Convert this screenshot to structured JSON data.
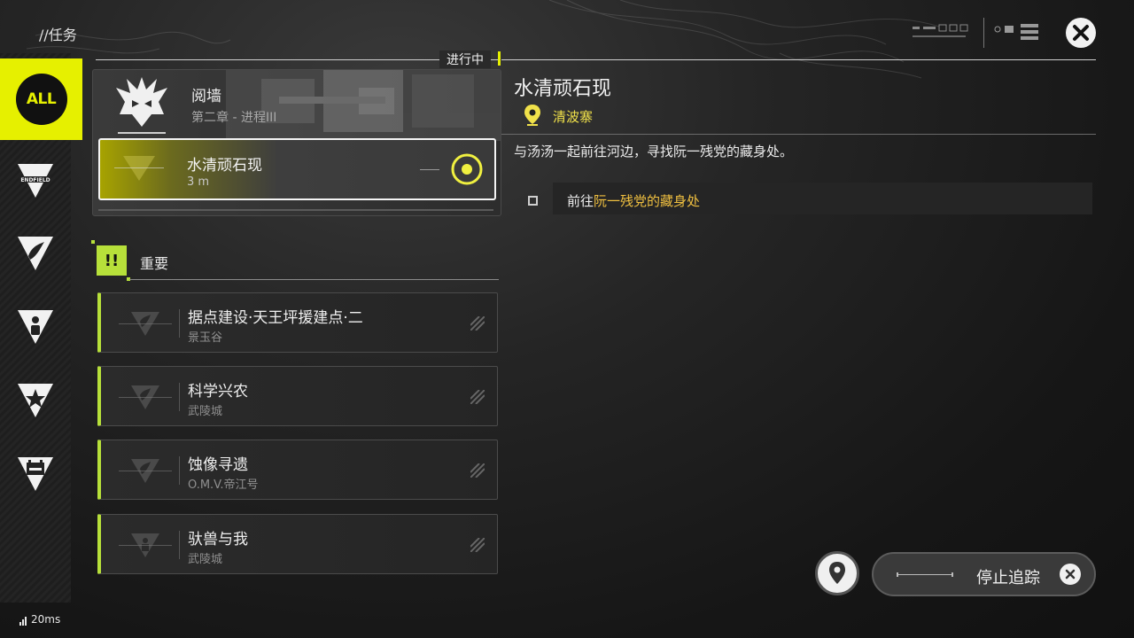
{
  "header": {
    "title": "//任务"
  },
  "sidebar": {
    "items": [
      {
        "label": "ALL",
        "icon": "all-badge",
        "active": true
      },
      {
        "label": "",
        "icon": "endfield-icon"
      },
      {
        "label": "",
        "icon": "origami-icon"
      },
      {
        "label": "",
        "icon": "person-icon"
      },
      {
        "label": "",
        "icon": "star-icon"
      },
      {
        "label": "",
        "icon": "calendar-icon"
      }
    ]
  },
  "in_progress": {
    "label": "进行中",
    "chapter_title": "阅墙",
    "chapter_subtitle": "第二章 - 进程III",
    "active_quest": {
      "name": "水清顽石现",
      "distance": "3 m"
    }
  },
  "important": {
    "badge": "!!",
    "label": "重要",
    "quests": [
      {
        "name": "据点建设·天王坪援建点·二",
        "location": "景玉谷"
      },
      {
        "name": "科学兴农",
        "location": "武陵城"
      },
      {
        "name": "蚀像寻遗",
        "location": "O.M.V.帝江号"
      },
      {
        "name": "驮兽与我",
        "location": "武陵城"
      }
    ]
  },
  "detail": {
    "title": "水清顽石现",
    "location": "清波寨",
    "description": "与汤汤一起前往河边，寻找阮一残党的藏身处。",
    "objective_prefix": "前往",
    "objective_target": "阮一残党的藏身处"
  },
  "controls": {
    "stop_tracking_label": "停止追踪"
  },
  "status": {
    "ping": "20ms"
  },
  "colors": {
    "accent": "#e6f000",
    "important": "#b7e03a",
    "location": "#f0e14a"
  }
}
